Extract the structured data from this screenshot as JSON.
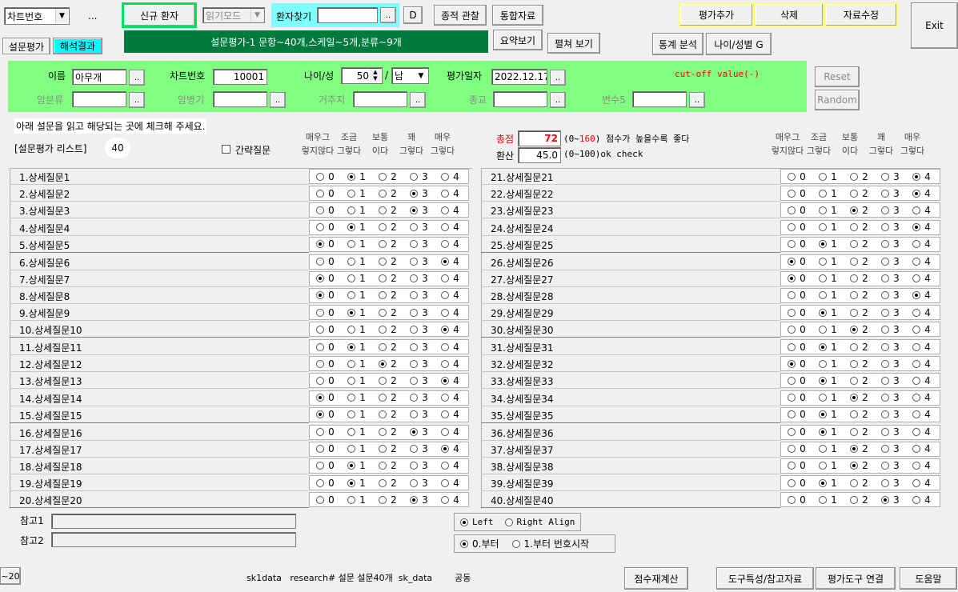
{
  "toolbar": {
    "chart_select": "차트번호",
    "ellipsis": "...",
    "new_patient": "신규 환자",
    "read_mode": "읽기모드",
    "patient_search_label": "환자찾기",
    "patient_search_value": "",
    "dots_btn": "..",
    "d_btn": "D",
    "history_btn": "종적 관찰",
    "integrated_btn": "통합자료",
    "add_eval": "평가추가",
    "delete": "삭제",
    "edit_data": "자료수정",
    "exit": "Exit",
    "summary_btn": "요약보기",
    "expand_btn": "펼쳐 보기",
    "stats_btn": "통계 분석",
    "age_gender_btn": "나이/성별 G",
    "banner": "설문평가-1 문항~40개,스케일~5개,분류~9개"
  },
  "tabs": [
    "설문평가",
    "해석결과"
  ],
  "patient": {
    "name_label": "이름",
    "name": "아무개",
    "chart_label": "차트번호",
    "chart_no": "10001",
    "age_label": "나이/성",
    "age": "50",
    "slash": "/",
    "gender": "남",
    "date_label": "평가일자",
    "date": "2022.12.17",
    "cutoff": "cut-off value(-)",
    "cancer_type_label": "암분류",
    "cancer_stage_label": "암병기",
    "residence_label": "거주지",
    "religion_label": "종교",
    "var5_label": "변수5",
    "reset": "Reset",
    "random": "Random"
  },
  "instructions": "아래 설문을 읽고 해당되는 곳에 체크해 주세요.",
  "list_label": "[설문평가 리스트]",
  "list_count": "40",
  "short_q_label": "간략질문",
  "score": {
    "total_label": "총점",
    "total": "72",
    "total_range_open": "(0~",
    "total_range_max": "160",
    "total_range_close": ")",
    "total_note": "점수가 높을수록 좋다",
    "converted_label": "환산",
    "converted": "45.0",
    "converted_range": "(0~100)",
    "converted_note": "ok check"
  },
  "scale_headers": [
    {
      "top": "매우그",
      "bottom": "렇지않다"
    },
    {
      "top": "조금",
      "bottom": "그렇다"
    },
    {
      "top": "보통",
      "bottom": "이다"
    },
    {
      "top": "꽤",
      "bottom": "그렇다"
    },
    {
      "top": "매우",
      "bottom": "그렇다"
    }
  ],
  "options": [
    "0",
    "1",
    "2",
    "3",
    "4"
  ],
  "questions": [
    {
      "label": "1.상세질문1",
      "value": 1
    },
    {
      "label": "2.상세질문2",
      "value": 3
    },
    {
      "label": "3.상세질문3",
      "value": 3
    },
    {
      "label": "4.상세질문4",
      "value": 1
    },
    {
      "label": "5.상세질문5",
      "value": 0
    },
    {
      "label": "6.상세질문6",
      "value": 4
    },
    {
      "label": "7.상세질문7",
      "value": 0
    },
    {
      "label": "8.상세질문8",
      "value": 0
    },
    {
      "label": "9.상세질문9",
      "value": 1
    },
    {
      "label": "10.상세질문10",
      "value": 4
    },
    {
      "label": "11.상세질문11",
      "value": 1
    },
    {
      "label": "12.상세질문12",
      "value": 2
    },
    {
      "label": "13.상세질문13",
      "value": 4
    },
    {
      "label": "14.상세질문14",
      "value": 0
    },
    {
      "label": "15.상세질문15",
      "value": 0
    },
    {
      "label": "16.상세질문16",
      "value": 3
    },
    {
      "label": "17.상세질문17",
      "value": 4
    },
    {
      "label": "18.상세질문18",
      "value": 1
    },
    {
      "label": "19.상세질문19",
      "value": 1
    },
    {
      "label": "20.상세질문20",
      "value": 3
    },
    {
      "label": "21.상세질문21",
      "value": 4
    },
    {
      "label": "22.상세질문22",
      "value": 4
    },
    {
      "label": "23.상세질문23",
      "value": 2
    },
    {
      "label": "24.상세질문24",
      "value": 4
    },
    {
      "label": "25.상세질문25",
      "value": 1
    },
    {
      "label": "26.상세질문26",
      "value": 0
    },
    {
      "label": "27.상세질문27",
      "value": 0
    },
    {
      "label": "28.상세질문28",
      "value": 4
    },
    {
      "label": "29.상세질문29",
      "value": 1
    },
    {
      "label": "30.상세질문30",
      "value": 2
    },
    {
      "label": "31.상세질문31",
      "value": 1
    },
    {
      "label": "32.상세질문32",
      "value": 0
    },
    {
      "label": "33.상세질문33",
      "value": 1
    },
    {
      "label": "34.상세질문34",
      "value": 2
    },
    {
      "label": "35.상세질문35",
      "value": 1
    },
    {
      "label": "36.상세질문36",
      "value": 1
    },
    {
      "label": "37.상세질문37",
      "value": 2
    },
    {
      "label": "38.상세질문38",
      "value": 2
    },
    {
      "label": "39.상세질문39",
      "value": 1
    },
    {
      "label": "40.상세질문40",
      "value": 3
    }
  ],
  "notes": {
    "ref1_label": "참고1",
    "ref2_label": "참고2"
  },
  "align": {
    "left": "Left",
    "right": "Right Align",
    "selected": "left"
  },
  "numbering": {
    "zero": "0.부터",
    "one": "1.부터 번호시작",
    "selected": "zero"
  },
  "footer": {
    "tilde20": "~20",
    "status": "sk1data   research# 설문 설문40개  sk_data        공동",
    "recalc": "점수재계산",
    "tool_info": "도구특성/참고자료",
    "tool_link": "평가도구 연결",
    "help": "도움말"
  },
  "colors": {
    "panel": "#80ff80",
    "banner": "#007a3d",
    "tab_active": "#00ffff",
    "highlight_yellow": "#ffff80",
    "total_red": "#ff0000"
  }
}
